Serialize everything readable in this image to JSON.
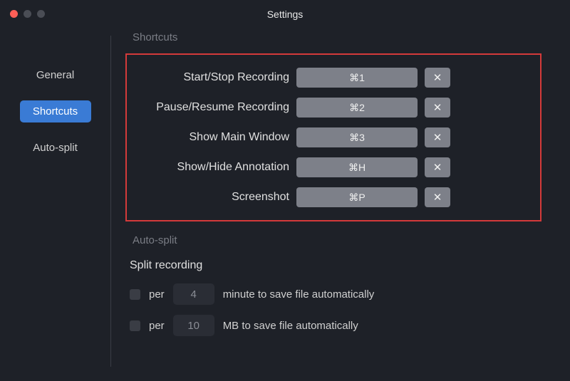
{
  "window": {
    "title": "Settings"
  },
  "sidebar": {
    "items": [
      {
        "label": "General"
      },
      {
        "label": "Shortcuts"
      },
      {
        "label": "Auto-split"
      }
    ]
  },
  "sections": {
    "shortcuts_header": "Shortcuts",
    "autosplit_header": "Auto-split",
    "split_title": "Split recording"
  },
  "shortcuts": [
    {
      "label": "Start/Stop Recording",
      "key": "⌘1",
      "clear": "✕"
    },
    {
      "label": "Pause/Resume Recording",
      "key": "⌘2",
      "clear": "✕"
    },
    {
      "label": "Show Main Window",
      "key": "⌘3",
      "clear": "✕"
    },
    {
      "label": "Show/Hide Annotation",
      "key": "⌘H",
      "clear": "✕"
    },
    {
      "label": "Screenshot",
      "key": "⌘P",
      "clear": "✕"
    }
  ],
  "autosplit": {
    "per_label": "per",
    "rows": [
      {
        "value": "4",
        "suffix": "minute to save file automatically"
      },
      {
        "value": "10",
        "suffix": "MB to save file automatically"
      }
    ]
  }
}
